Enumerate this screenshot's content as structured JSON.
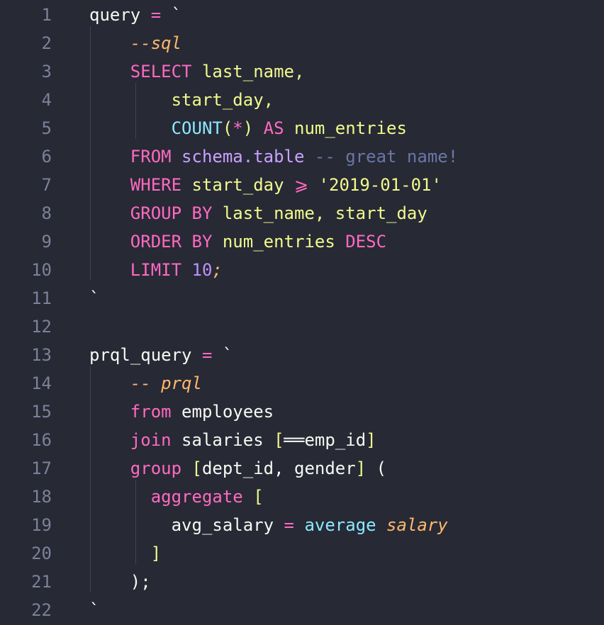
{
  "colors": {
    "background": "#272935",
    "line_number": "#7c8199",
    "default": "#f8f8f2",
    "keyword": "#ff6ac1",
    "function": "#8be9fd",
    "string": "#f1fa8c",
    "number": "#bd93f9",
    "comment": "#6b76a6",
    "italic": "#ffb86c"
  },
  "lines": [
    {
      "n": "1",
      "tokens": [
        [
          "default",
          "query "
        ],
        [
          "keyword",
          "="
        ],
        [
          "default",
          " `"
        ]
      ]
    },
    {
      "n": "2",
      "tokens": [
        [
          "default",
          "    "
        ],
        [
          "italic",
          "--sql"
        ]
      ]
    },
    {
      "n": "3",
      "tokens": [
        [
          "default",
          "    "
        ],
        [
          "keyword",
          "SELECT"
        ],
        [
          "ident",
          " last_name,"
        ]
      ]
    },
    {
      "n": "4",
      "tokens": [
        [
          "default",
          "        "
        ],
        [
          "ident",
          "start_day,"
        ]
      ]
    },
    {
      "n": "5",
      "tokens": [
        [
          "default",
          "        "
        ],
        [
          "func",
          "COUNT"
        ],
        [
          "ident",
          "("
        ],
        [
          "keyword",
          "*"
        ],
        [
          "ident",
          ")"
        ],
        [
          "keyword",
          " AS"
        ],
        [
          "ident",
          " num_entries"
        ]
      ]
    },
    {
      "n": "6",
      "tokens": [
        [
          "default",
          "    "
        ],
        [
          "keyword",
          "FROM"
        ],
        [
          "schema",
          " schema.table"
        ],
        [
          "comment",
          " -- great name!"
        ]
      ]
    },
    {
      "n": "7",
      "tokens": [
        [
          "default",
          "    "
        ],
        [
          "keyword",
          "WHERE"
        ],
        [
          "ident",
          " start_day "
        ],
        [
          "keyword",
          "⩾"
        ],
        [
          "string",
          " '2019-01-01'"
        ]
      ]
    },
    {
      "n": "8",
      "tokens": [
        [
          "default",
          "    "
        ],
        [
          "keyword",
          "GROUP BY"
        ],
        [
          "ident",
          " last_name, start_day"
        ]
      ]
    },
    {
      "n": "9",
      "tokens": [
        [
          "default",
          "    "
        ],
        [
          "keyword",
          "ORDER BY"
        ],
        [
          "ident",
          " num_entries "
        ],
        [
          "keyword",
          "DESC"
        ]
      ]
    },
    {
      "n": "10",
      "tokens": [
        [
          "default",
          "    "
        ],
        [
          "keyword",
          "LIMIT"
        ],
        [
          "number",
          " 10"
        ],
        [
          "italic",
          ";"
        ]
      ]
    },
    {
      "n": "11",
      "tokens": [
        [
          "default",
          "`"
        ]
      ]
    },
    {
      "n": "12",
      "tokens": []
    },
    {
      "n": "13",
      "tokens": [
        [
          "default",
          "prql_query "
        ],
        [
          "keyword",
          "="
        ],
        [
          "default",
          " `"
        ]
      ]
    },
    {
      "n": "14",
      "tokens": [
        [
          "default",
          "    "
        ],
        [
          "italic",
          "-- prql"
        ]
      ]
    },
    {
      "n": "15",
      "tokens": [
        [
          "default",
          "    "
        ],
        [
          "keyword",
          "from"
        ],
        [
          "default",
          " employees"
        ]
      ]
    },
    {
      "n": "16",
      "tokens": [
        [
          "default",
          "    "
        ],
        [
          "keyword",
          "join"
        ],
        [
          "default",
          " salaries "
        ],
        [
          "ident",
          "["
        ],
        [
          "default",
          "══emp_id"
        ],
        [
          "ident",
          "]"
        ]
      ]
    },
    {
      "n": "17",
      "tokens": [
        [
          "default",
          "    "
        ],
        [
          "keyword",
          "group"
        ],
        [
          "ident",
          " ["
        ],
        [
          "default",
          "dept_id, gender"
        ],
        [
          "ident",
          "]"
        ],
        [
          "default",
          " ("
        ]
      ]
    },
    {
      "n": "18",
      "tokens": [
        [
          "default",
          "      "
        ],
        [
          "keyword",
          "aggregate"
        ],
        [
          "ident",
          " ["
        ]
      ]
    },
    {
      "n": "19",
      "tokens": [
        [
          "default",
          "        avg_salary "
        ],
        [
          "keyword",
          "="
        ],
        [
          "func",
          " average"
        ],
        [
          "italic",
          " salary"
        ]
      ]
    },
    {
      "n": "20",
      "tokens": [
        [
          "default",
          "      "
        ],
        [
          "ident",
          "]"
        ]
      ]
    },
    {
      "n": "21",
      "tokens": [
        [
          "default",
          "    );"
        ]
      ]
    },
    {
      "n": "22",
      "tokens": [
        [
          "default",
          "`"
        ]
      ]
    }
  ]
}
